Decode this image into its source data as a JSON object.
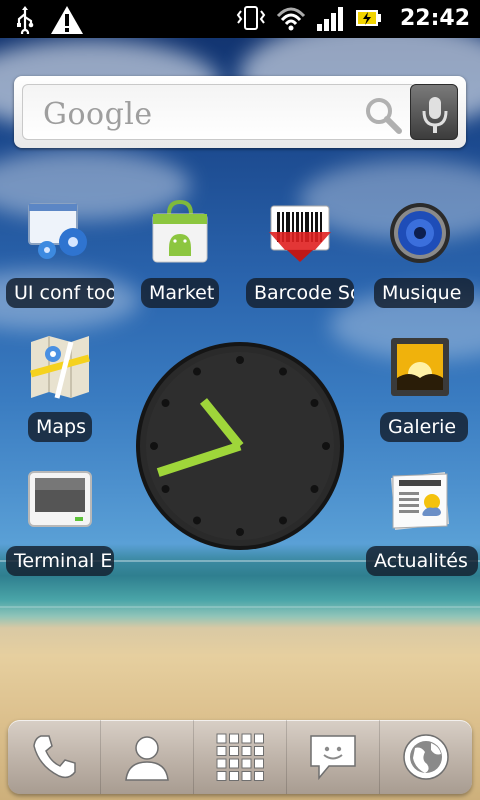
{
  "status_bar": {
    "time": "22:42",
    "left_icons": [
      "usb-icon",
      "warning-icon"
    ],
    "right_icons": [
      "vibrate-icon",
      "wifi-icon",
      "signal-icon",
      "battery-charging-icon"
    ]
  },
  "search": {
    "brand_text": "Google",
    "icons": [
      "search-icon",
      "mic-icon"
    ]
  },
  "apps": [
    {
      "label": "UI conf too",
      "icon": "ui-config-icon"
    },
    {
      "label": "Market",
      "icon": "market-icon"
    },
    {
      "label": "Barcode Sc",
      "icon": "barcode-scanner-icon"
    },
    {
      "label": "Musique",
      "icon": "music-icon"
    },
    {
      "label": "Maps",
      "icon": "maps-icon"
    },
    {
      "label": "Galerie",
      "icon": "gallery-icon"
    },
    {
      "label": "Terminal E",
      "icon": "terminal-icon"
    },
    {
      "label": "Actualités",
      "icon": "news-icon"
    }
  ],
  "clock_widget": {
    "hour": 22,
    "minute": 42
  },
  "dock": {
    "items": [
      "phone-icon",
      "contacts-icon",
      "app-drawer-icon",
      "messaging-icon",
      "browser-icon"
    ]
  }
}
